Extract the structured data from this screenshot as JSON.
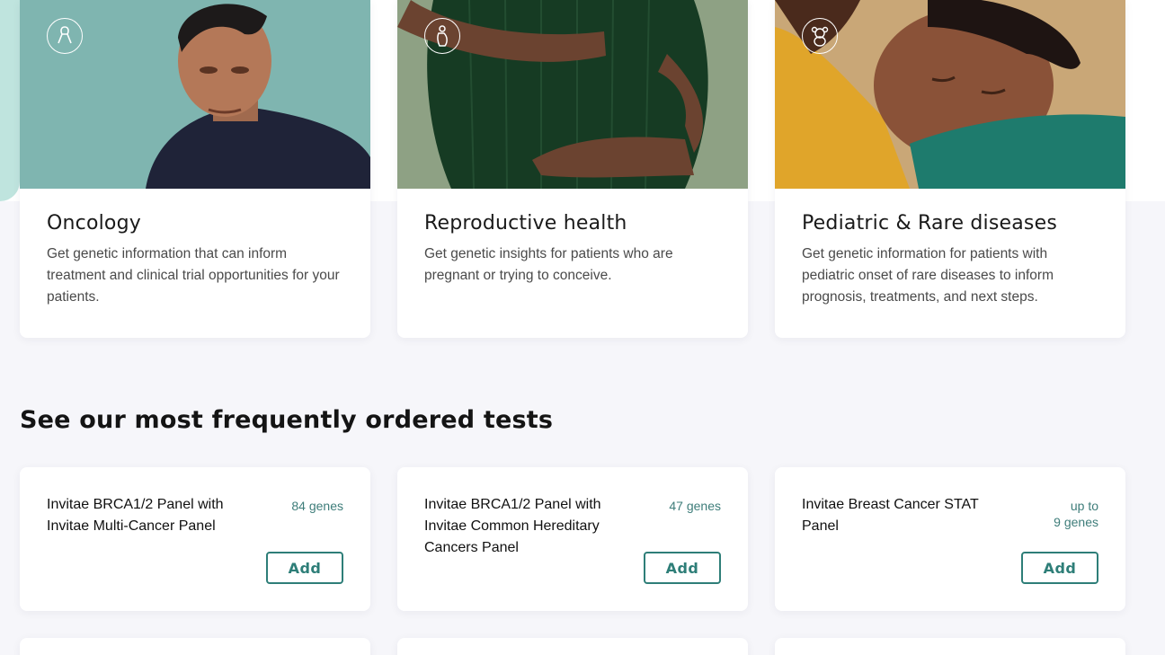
{
  "categories": [
    {
      "title": "Oncology",
      "description": "Get genetic information that can inform treatment and clinical trial opportunities for your patients.",
      "icon": "ribbon-icon",
      "image_bg": "#7fb5b0"
    },
    {
      "title": "Reproductive health",
      "description": "Get genetic insights for patients who are pregnant or trying to conceive.",
      "icon": "pregnancy-icon",
      "image_bg": "#8ea184"
    },
    {
      "title": "Pediatric & Rare diseases",
      "description": "Get genetic information for patients with pediatric onset of rare diseases to inform prognosis, treatments, and next steps.",
      "icon": "teddy-bear-icon",
      "image_bg": "#c9a777"
    }
  ],
  "tests_section": {
    "heading": "See our most frequently ordered tests",
    "add_label": "Add",
    "tests": [
      {
        "name": "Invitae BRCA1/2 Panel with Invitae Multi-Cancer Panel",
        "genes": "84 genes"
      },
      {
        "name": "Invitae BRCA1/2 Panel with Invitae Common Hereditary Cancers Panel",
        "genes": "47 genes"
      },
      {
        "name": "Invitae Breast Cancer STAT Panel",
        "genes_prefix": "up to",
        "genes": "9 genes"
      }
    ]
  },
  "colors": {
    "accent": "#2e7e78",
    "gene_text": "#3e7d7a",
    "page_bg": "#f6f6fa"
  }
}
